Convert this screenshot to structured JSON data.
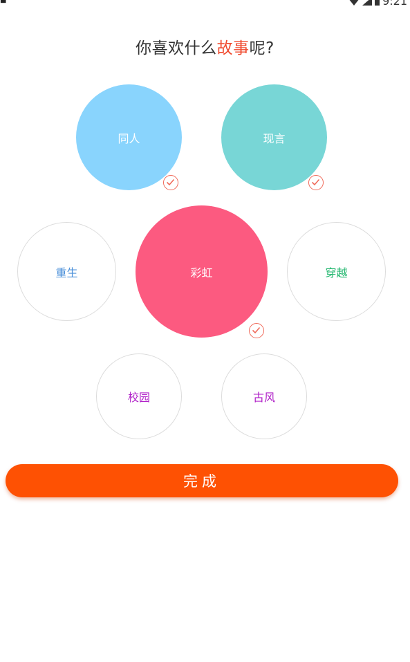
{
  "status_bar": {
    "time": "9:21",
    "icons": [
      "notification-a-icon",
      "wifi-icon",
      "cell-signal-icon",
      "battery-icon"
    ]
  },
  "title": {
    "prefix": "你喜欢什么",
    "highlight": "故事",
    "suffix": "呢?"
  },
  "tags": [
    {
      "label": "同人",
      "selected": true,
      "color": "#89d4fd",
      "text_color": "#ffffff"
    },
    {
      "label": "现言",
      "selected": true,
      "color": "#78d6d6",
      "text_color": "#ffffff"
    },
    {
      "label": "重生",
      "selected": false,
      "color": "#ffffff",
      "text_color": "#4a8fd9"
    },
    {
      "label": "彩虹",
      "selected": true,
      "color": "#fc5a80",
      "text_color": "#ffffff"
    },
    {
      "label": "穿越",
      "selected": false,
      "color": "#ffffff",
      "text_color": "#1db56b"
    },
    {
      "label": "校园",
      "selected": false,
      "color": "#ffffff",
      "text_color": "#b020c8"
    },
    {
      "label": "古风",
      "selected": false,
      "color": "#ffffff",
      "text_color": "#b020c8"
    }
  ],
  "done_button": {
    "label": "完成",
    "color": "#fe5103"
  },
  "colors": {
    "title_highlight": "#f04a2e",
    "check": "#f06a5a"
  }
}
